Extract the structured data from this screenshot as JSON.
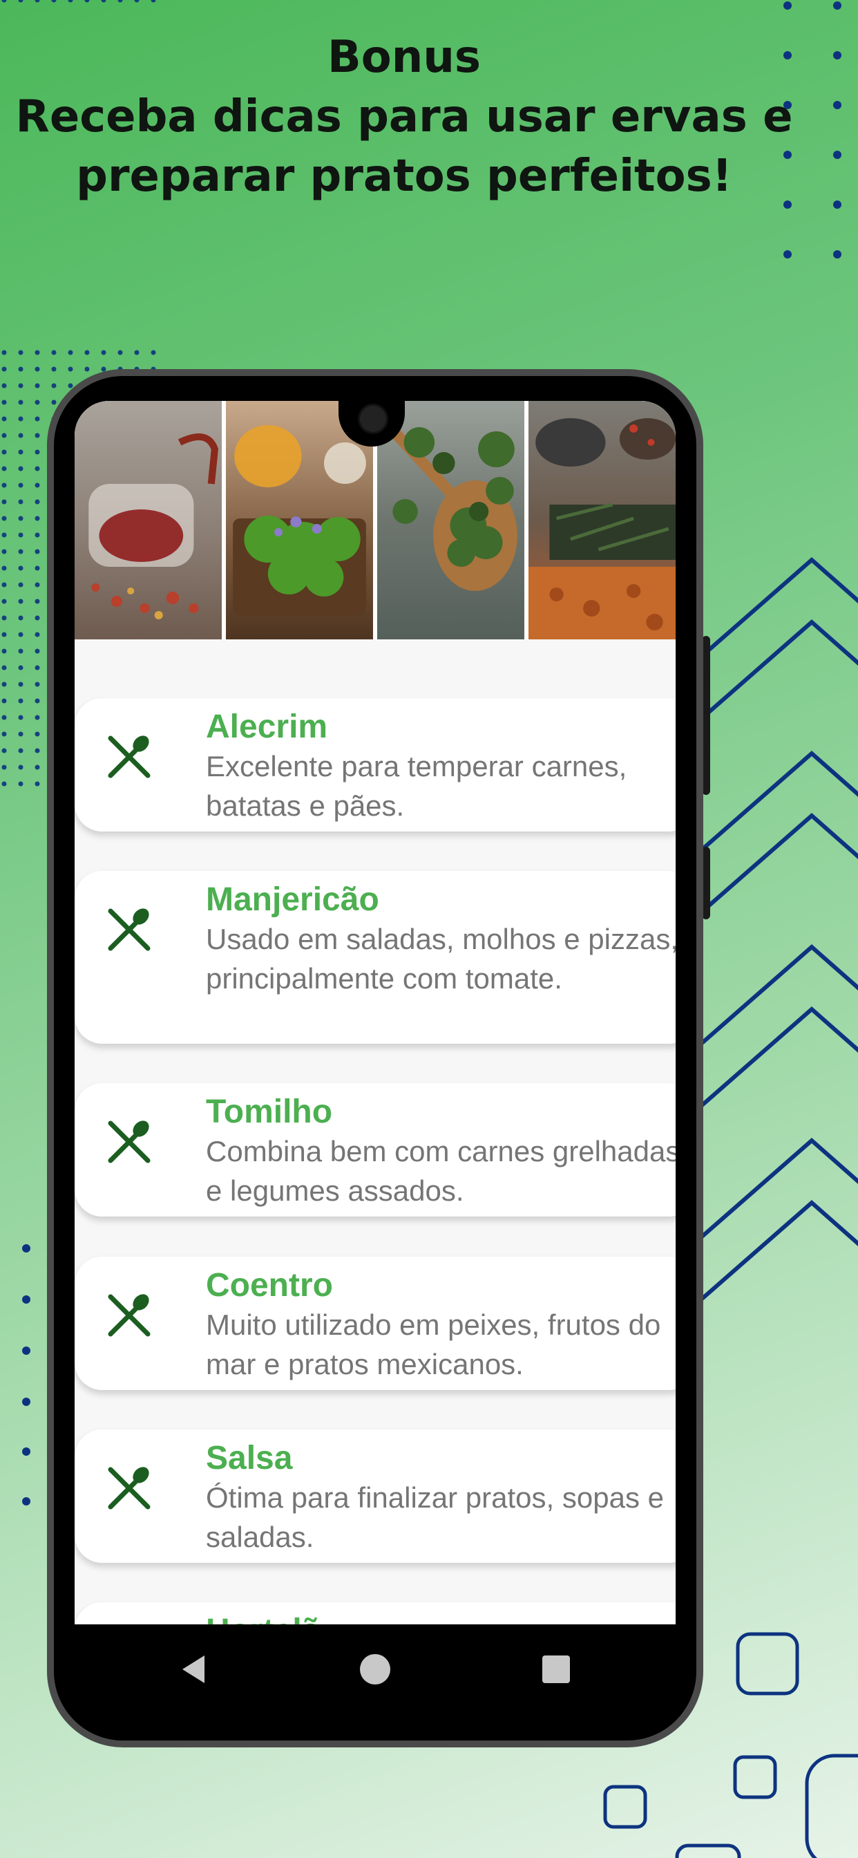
{
  "headline": {
    "line1": "Bonus",
    "line2": "Receba dicas para usar ervas e",
    "line3": "preparar pratos perfeitos!"
  },
  "colors": {
    "accent_green": "#4caf50",
    "icon_green": "#1b5e20",
    "deco_blue": "#0d3380"
  },
  "banner": {
    "images": [
      "herbal-tea-photo",
      "fresh-herbs-basket-photo",
      "dried-herbs-spoon-photo",
      "spices-bowls-photo"
    ]
  },
  "tips": [
    {
      "icon": "fork-spoon-icon",
      "title": "Alecrim",
      "description": "Excelente para temperar carnes, batatas e pães."
    },
    {
      "icon": "fork-spoon-icon",
      "title": "Manjericão",
      "description": "Usado em saladas, molhos e pizzas, principalmente com tomate."
    },
    {
      "icon": "fork-spoon-icon",
      "title": "Tomilho",
      "description": "Combina bem com carnes grelhadas e legumes assados."
    },
    {
      "icon": "fork-spoon-icon",
      "title": "Coentro",
      "description": "Muito utilizado em peixes, frutos do mar e pratos mexicanos."
    },
    {
      "icon": "fork-spoon-icon",
      "title": "Salsa",
      "description": "Ótima para finalizar pratos, sopas e saladas."
    },
    {
      "icon": "fork-spoon-icon",
      "title": "Hortelã",
      "description": ""
    }
  ],
  "navbar": {
    "buttons": [
      "back-icon",
      "home-icon",
      "recents-icon"
    ]
  }
}
